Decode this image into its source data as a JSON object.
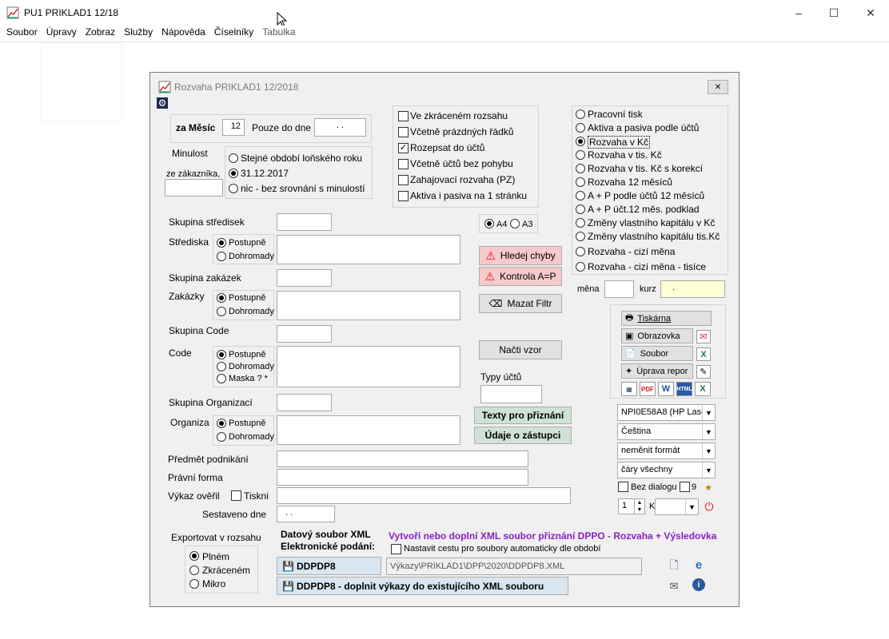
{
  "app": {
    "title": "PU1 PRIKLAD1 12/18"
  },
  "menu": [
    "Soubor",
    "Úpravy",
    "Zobraz",
    "Služby",
    "Nápověda",
    "Číselníky",
    "Tabulka"
  ],
  "dialog": {
    "title": "Rozvaha   PRIKLAD1  12/2018"
  },
  "period": {
    "month_label": "za Měsíc",
    "month_value": "12",
    "only_to_label": "Pouze do dne",
    "only_to_value": ". .",
    "minulost_label": "Minulost",
    "customer_label": "ze zákazníka,",
    "options": [
      "Stejné období loňského roku",
      "31.12.2017",
      "nic - bez srovnání s minulostí"
    ]
  },
  "checks": [
    {
      "label": "Ve zkráceném rozsahu",
      "checked": false
    },
    {
      "label": "Včetně prázdných řádků",
      "checked": false
    },
    {
      "label": "Rozepsat do účtů",
      "checked": true
    },
    {
      "label": "Včetně účtů bez pohybu",
      "checked": false
    },
    {
      "label": "Zahajovací rozvaha (PZ)",
      "checked": false
    },
    {
      "label": "Aktiva i pasiva na 1 stránku",
      "checked": false
    }
  ],
  "report_types": [
    "Pracovní tisk",
    "Aktiva a pasiva podle účtů",
    "Rozvaha v Kč",
    "Rozvaha v tis. Kč",
    "Rozvaha v tis. Kč s korekcí",
    "Rozvaha 12 měsíců",
    "A + P podle účtů 12 měsíců",
    "A + P účt.12 měs. podklad",
    "Změny vlastního kapitálu v Kč",
    "Změny vlastního kapitálu tis.Kč",
    "Rozvaha - cizí měna",
    "Rozvaha - cizí měna - tisíce"
  ],
  "filters": {
    "skupina_stredisek": "Skupina středisek",
    "strediska": "Střediska",
    "skupina_zakazek": "Skupina zakázek",
    "zakazky": "Zakázky",
    "skupina_code": "Skupina Code",
    "code": "Code",
    "skupina_org": "Skupina Organizací",
    "organizace": "Organiza",
    "postupne": "Postupně",
    "dohromady": "Dohromady",
    "maska": "Maska  ? *"
  },
  "paper": {
    "a4": "A4",
    "a3": "A3"
  },
  "buttons": {
    "hledej": "Hledej chyby",
    "kontrola": "Kontrola A=P",
    "mazat": "Mazat Filtr",
    "nacti": "Načti vzor",
    "typy": "Typy účtů",
    "texty": "Texty pro přiznání",
    "udaje": "Údaje o zástupci"
  },
  "currency": {
    "mena": "měna",
    "kurz": "kurz",
    "kurz_value": "."
  },
  "output": {
    "tiskarna": "Tiskárna",
    "obrazovka": "Obrazovka",
    "soubor": "Soubor",
    "uprava": "Úprava repor",
    "printer": "NPI0E58A8 (HP Lase",
    "language": "Čeština",
    "format": "neměnit formát",
    "lines": "čáry všechny",
    "bez_dialogu": "Bez dialogu",
    "nine": "9",
    "copies": "1",
    "k": "K"
  },
  "fields": {
    "predmet": "Předmět podnikání",
    "pravni": "Právní forma",
    "vykaz": "Výkaz ověřil",
    "tiskni": "Tiskni",
    "sestaveno": "Sestaveno dne",
    "sestaveno_value": ". ."
  },
  "export": {
    "label": "Exportovat v rozsahu",
    "options": [
      "Plném",
      "Zkráceném",
      "Mikro"
    ],
    "xml_label1": "Datový soubor XML",
    "xml_label2": "Elektronické podání:",
    "headline": "Vytvoří nebo doplní XML soubor přiznání DPPO - Rozvaha + Výsledovka",
    "auto_path": "Nastavit cestu pro soubory automaticky dle období",
    "btn1": "DDPDP8",
    "btn2": "DDPDP8 - doplnit výkazy do existujícího XML souboru",
    "path": "Výkazy\\PRIKLAD1\\DPP\\2020\\DDPDP8.XML"
  }
}
